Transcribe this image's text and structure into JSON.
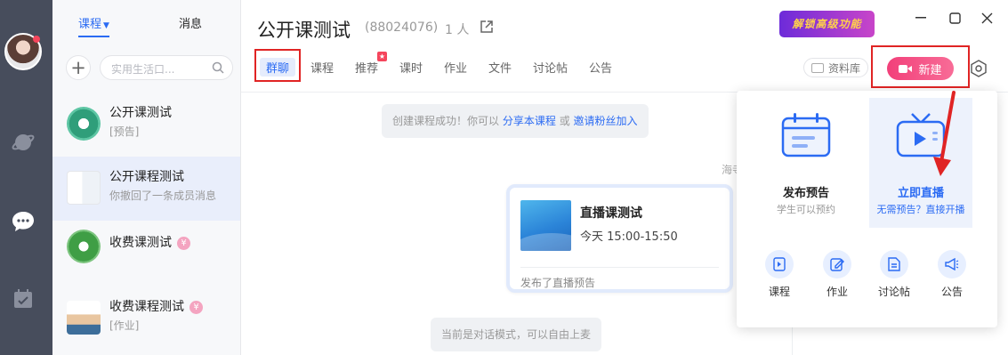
{
  "sidebar": {
    "avatar_alt": "user avatar"
  },
  "list": {
    "tabs": [
      {
        "label": "课程"
      },
      {
        "label": "消息"
      }
    ],
    "search_placeholder": "实用生活口...",
    "items": [
      {
        "title": "公开课测试",
        "sub": "[预告]",
        "paid": false
      },
      {
        "title": "公开课程测试",
        "sub": "你撤回了一条成员消息",
        "paid": false
      },
      {
        "title": "收费课测试",
        "sub": "",
        "paid": true
      },
      {
        "title": "收费课程测试",
        "sub": "[作业]",
        "paid": true
      }
    ],
    "paid_symbol": "¥"
  },
  "header": {
    "title": "公开课测试",
    "id": "(88024076)",
    "members": "1 人",
    "unlock": "解锁高级功能"
  },
  "tabs": [
    {
      "label": "群聊"
    },
    {
      "label": "课程"
    },
    {
      "label": "推荐"
    },
    {
      "label": "课时"
    },
    {
      "label": "作业"
    },
    {
      "label": "文件"
    },
    {
      "label": "讨论帖"
    },
    {
      "label": "公告"
    }
  ],
  "toolbar": {
    "library": "资料库",
    "new": "新建"
  },
  "chat": {
    "system1_prefix": "创建课程成功！你可以",
    "system1_link1": "分享本课程",
    "system1_or": "或",
    "system1_link2": "邀请粉丝加入",
    "sender": "海寺",
    "card": {
      "title": "直播课测试",
      "time": "今天  15:00-15:50",
      "foot": "发布了直播预告"
    },
    "system2": "当前是对话模式，可以自由上麦"
  },
  "popup": {
    "opt1": {
      "title": "发布预告",
      "sub": "学生可以预约"
    },
    "opt2": {
      "title": "立即直播",
      "sub": "无需预告？直接开播"
    },
    "items": [
      {
        "label": "课程"
      },
      {
        "label": "作业"
      },
      {
        "label": "讨论帖"
      },
      {
        "label": "公告"
      }
    ]
  },
  "colors": {
    "accent": "#2b6bf3",
    "pink": "#f2407a",
    "highlight": "#e02424",
    "rail": "#474d5c"
  }
}
